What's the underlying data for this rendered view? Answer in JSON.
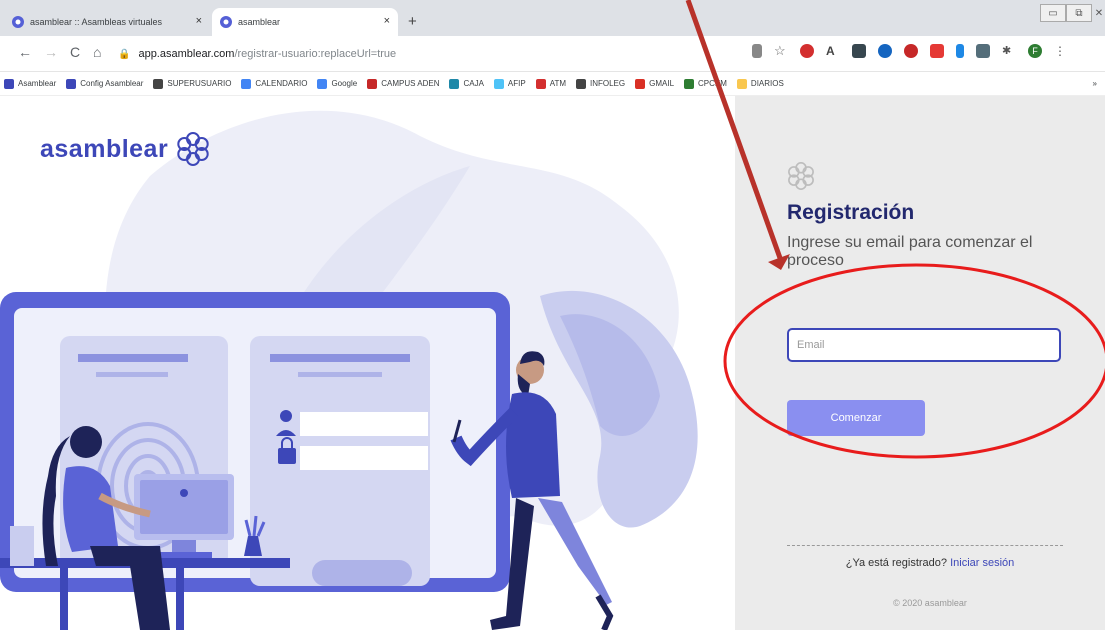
{
  "browser": {
    "tabs": [
      {
        "title": "asamblear :: Asambleas virtuales",
        "close": "×"
      },
      {
        "title": "asamblear",
        "close": "×"
      }
    ],
    "new_tab": "+",
    "url_host": "app.asamblear.com",
    "url_path": "/registrar-usuario:replaceUrl=true",
    "nav": {
      "back": "←",
      "forward": "→",
      "reload": "C",
      "home": "⌂"
    },
    "window": {
      "minimize": "▭",
      "restore": "⧉",
      "close": "✕"
    }
  },
  "bookmarks": [
    {
      "label": "Asamblear",
      "color": "#3d47b8"
    },
    {
      "label": "Config Asamblear",
      "color": "#3d47b8"
    },
    {
      "label": "SUPERUSUARIO",
      "color": "#444444"
    },
    {
      "label": "CALENDARIO",
      "color": "#4285f4"
    },
    {
      "label": "Google",
      "color": "#4285f4"
    },
    {
      "label": "CAMPUS ADEN",
      "color": "#c62828"
    },
    {
      "label": "CAJA",
      "color": "#1e88a8"
    },
    {
      "label": "AFIP",
      "color": "#4fc3f7"
    },
    {
      "label": "ATM",
      "color": "#d32f2f"
    },
    {
      "label": "INFOLEG",
      "color": "#444444"
    },
    {
      "label": "GMAIL",
      "color": "#d93025"
    },
    {
      "label": "CPCEM",
      "color": "#2e7d32"
    },
    {
      "label": "DIARIOS",
      "color": "#f9c74f"
    }
  ],
  "bookmarks_more": "»",
  "brand": {
    "name": "asamblear",
    "color": "#3d47b8"
  },
  "registration": {
    "title": "Registración",
    "subtitle": "Ingrese su email para comenzar el proceso",
    "email_placeholder": "Email",
    "email_value": "",
    "submit_label": "Comenzar",
    "already_registered": "¿Ya está registrado?",
    "login_link": "Iniciar sesión",
    "copyright": "© 2020 asamblear"
  },
  "login_fields": {
    "user_mask": "● ● ● ● ●",
    "pass_mask": "● ● ● ● ● ●"
  },
  "annotation_colors": {
    "arrow": "#b8322a",
    "ellipse": "#e81c1c"
  }
}
